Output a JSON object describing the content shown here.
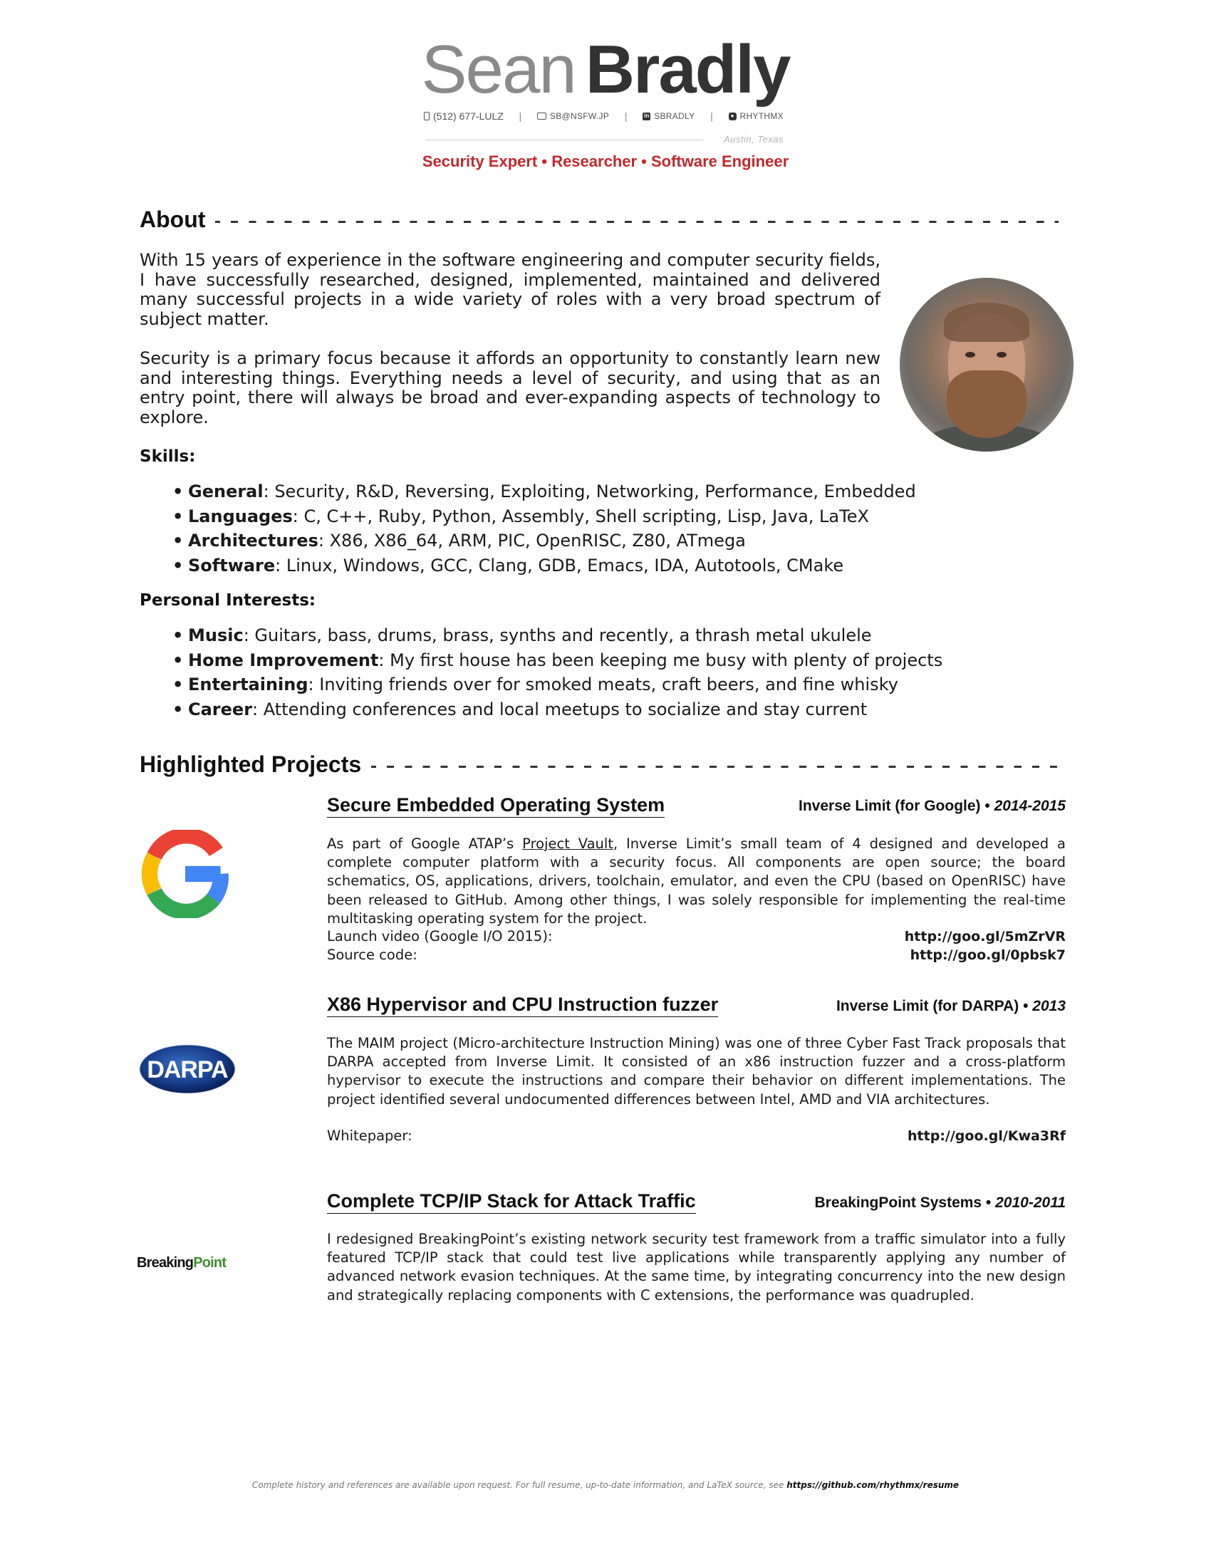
{
  "header": {
    "first_name": "Sean",
    "last_name": "Bradly",
    "contacts": [
      {
        "icon": "phone-icon",
        "text": "(512) 677-LULZ"
      },
      {
        "icon": "email-icon",
        "text": "SB@NSFW.JP"
      },
      {
        "icon": "linkedin-icon",
        "text": "SBRADLY"
      },
      {
        "icon": "github-icon",
        "text": "RHYTHMX"
      }
    ],
    "separator": "|",
    "location": "Austin, Texas",
    "tagline": "Security Expert • Researcher • Software Engineer",
    "tagline_color": "#c0292e"
  },
  "about": {
    "heading": "About",
    "paragraphs": [
      "With 15 years of experience in the software engineering and computer security fields, I have successfully researched, designed, implemented, maintained and delivered many successful projects in a wide variety of roles with a very broad spectrum of subject matter.",
      "Security is a primary focus because it affords an opportunity to constantly learn new and interesting things. Everything needs a level of security, and using that as an entry point, there will always be broad and ever-expanding aspects of technology to explore."
    ],
    "skills_heading": "Skills:",
    "skills": [
      {
        "label": "General",
        "text": ": Security, R&D, Reversing, Exploiting, Networking, Performance, Embedded"
      },
      {
        "label": "Languages",
        "text": ": C, C++, Ruby, Python, Assembly, Shell scripting, Lisp, Java, LaTeX"
      },
      {
        "label": "Architectures",
        "text": ": X86, X86_64, ARM, PIC, OpenRISC, Z80, ATmega"
      },
      {
        "label": "Software",
        "text": ": Linux, Windows, GCC, Clang, GDB, Emacs, IDA, Autotools, CMake"
      }
    ],
    "interests_heading": "Personal Interests:",
    "interests": [
      {
        "label": "Music",
        "text": ": Guitars, bass, drums, brass, synths and recently, a thrash metal ukulele"
      },
      {
        "label": "Home Improvement",
        "text": ": My first house has been keeping me busy with plenty of projects"
      },
      {
        "label": "Entertaining",
        "text": ": Inviting friends over for smoked meats, craft beers, and fine whisky"
      },
      {
        "label": "Career",
        "text": ": Attending conferences and local meetups to socialize and stay current"
      }
    ]
  },
  "projects": {
    "heading": "Highlighted Projects",
    "items": [
      {
        "title": "Secure Embedded Operating System",
        "org": "Inverse Limit (for Google) •",
        "years": "2014-2015",
        "logo": "google-logo",
        "desc_pre": "As part of Google ATAP’s ",
        "desc_link": "Project Vault",
        "desc_post": ", Inverse Limit’s small team of 4 designed and developed a complete computer platform with a security focus. All components are open source; the board schematics, OS, applications, drivers, toolchain, emulator, and even the CPU (based on OpenRISC) have been released to GitHub. Among other things, I was solely responsible for implementing the real-time multitasking operating system for the project.",
        "links": [
          {
            "label": "Launch video (Google I/O 2015):",
            "url": "http://goo.gl/5mZrVR"
          },
          {
            "label": "Source code:",
            "url": "http://goo.gl/0pbsk7"
          }
        ]
      },
      {
        "title": "X86 Hypervisor and CPU Instruction fuzzer",
        "org": "Inverse Limit (for DARPA) •",
        "years": "2013",
        "logo": "darpa-logo",
        "logo_text": "DARPA",
        "desc": "The MAIM project (Micro-architecture Instruction Mining) was one of three Cyber Fast Track proposals that DARPA accepted from Inverse Limit. It consisted of an x86 instruction fuzzer and a cross-platform hypervisor to execute the instructions and compare their behavior on different implementations. The project identified several undocumented differences between Intel, AMD and VIA architectures.",
        "links": [
          {
            "label": "Whitepaper:",
            "url": "http://goo.gl/Kwa3Rf"
          }
        ]
      },
      {
        "title": "Complete TCP/IP Stack for Attack Traffic",
        "org": "BreakingPoint Systems •",
        "years": "2010-2011",
        "logo": "breakingpoint-logo",
        "logo_text_1": "Breaking",
        "logo_text_2": "Point",
        "desc": "I redesigned BreakingPoint’s existing network security test framework from a traffic simulator into a fully featured TCP/IP stack that could test live applications while transparently applying any number of advanced network evasion techniques. At the same time, by integrating concurrency into the new design and strategically replacing components with C extensions, the performance was quadrupled."
      }
    ]
  },
  "footer": {
    "text": "Complete history and references are available upon request. For full resume, up-to-date information, and LaTeX source, see ",
    "url": "https://github.com/rhythmx/resume"
  }
}
